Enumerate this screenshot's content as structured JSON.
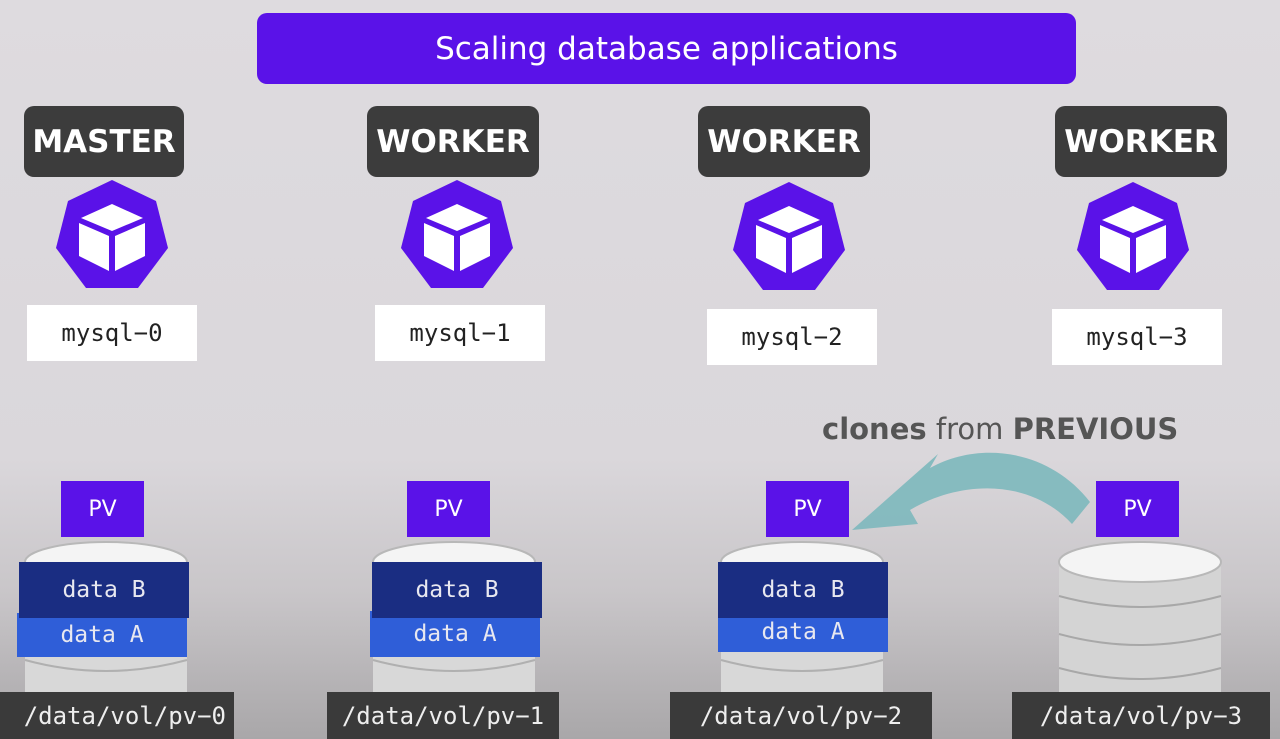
{
  "title": "Scaling database applications",
  "nodes": [
    {
      "role": "MASTER",
      "pod": "mysql−0",
      "pv": "PV",
      "data_b": "data B",
      "data_a": "data A",
      "path": "/data/vol/pv−0"
    },
    {
      "role": "WORKER",
      "pod": "mysql−1",
      "pv": "PV",
      "data_b": "data B",
      "data_a": "data A",
      "path": "/data/vol/pv−1"
    },
    {
      "role": "WORKER",
      "pod": "mysql−2",
      "pv": "PV",
      "data_b": "data B",
      "data_a": "data A",
      "path": "/data/vol/pv−2"
    },
    {
      "role": "WORKER",
      "pod": "mysql−3",
      "pv": "PV",
      "path": "/data/vol/pv−3"
    }
  ],
  "annotation": {
    "word1": "clones",
    "word2": "from",
    "word3": "PREVIOUS"
  },
  "colors": {
    "accent": "#5a12e8",
    "role_bg": "#3c3c3c",
    "data_b": "#1a2d82",
    "data_a": "#2f5ed8",
    "arrow": "#7fb8bd"
  },
  "icons": {
    "pod": "kubernetes-pod-icon",
    "storage": "database-cylinder-icon",
    "arrow": "curved-arrow-icon"
  }
}
